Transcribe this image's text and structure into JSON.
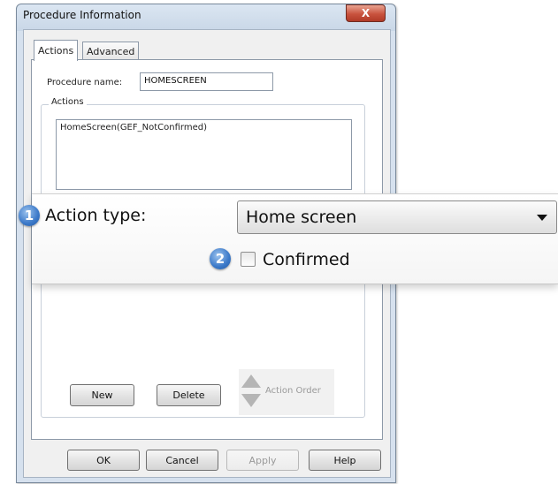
{
  "window": {
    "title": "Procedure Information",
    "close_glyph": "X"
  },
  "tabs": [
    {
      "label": "Actions",
      "active": true
    },
    {
      "label": "Advanced",
      "active": false
    }
  ],
  "procedure": {
    "label": "Procedure name:",
    "value": "HOMESCREEN"
  },
  "actions_group": {
    "label": "Actions",
    "items": [
      "HomeScreen(GEF_NotConfirmed)"
    ]
  },
  "callout": {
    "step1": {
      "number": "1",
      "label": "Action type:"
    },
    "action_type": {
      "selected": "Home screen"
    },
    "step2": {
      "number": "2",
      "label": "Confirmed",
      "checked": false
    }
  },
  "buttons": {
    "new": "New",
    "delete": "Delete",
    "action_order": "Action Order"
  },
  "footer": {
    "ok": "OK",
    "cancel": "Cancel",
    "apply": "Apply",
    "help": "Help"
  }
}
